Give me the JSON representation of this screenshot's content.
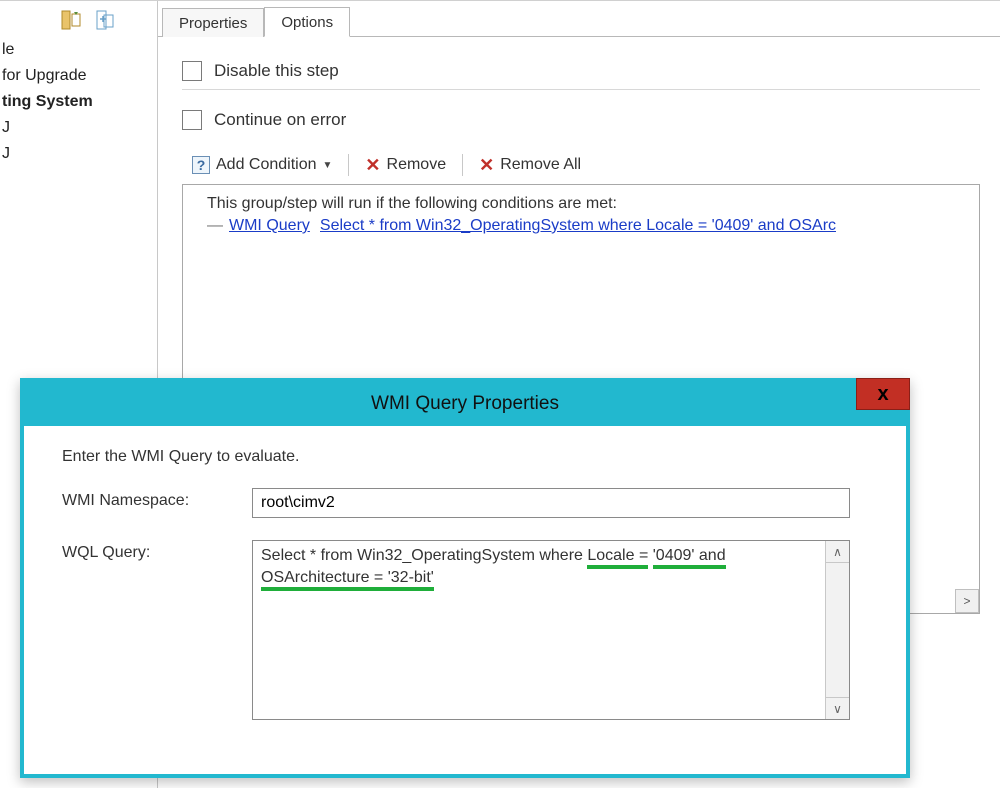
{
  "tree": {
    "items": [
      "le",
      "for Upgrade",
      "ting System",
      "J",
      "J"
    ],
    "selected_index": 2
  },
  "tabs": {
    "properties": "Properties",
    "options": "Options"
  },
  "options": {
    "disable_step": "Disable this step",
    "continue_on_error": "Continue on error",
    "add_condition": "Add Condition",
    "remove": "Remove",
    "remove_all": "Remove All"
  },
  "conditions": {
    "message": "This group/step will run if the following conditions are met:",
    "row_label": "WMI Query",
    "row_text": "Select * from Win32_OperatingSystem where Locale = '0409' and OSArc"
  },
  "dialog": {
    "title": "WMI Query Properties",
    "hint": "Enter the WMI Query to evaluate.",
    "namespace_label": "WMI Namespace:",
    "namespace_value": "root\\cimv2",
    "wql_label": "WQL Query:",
    "wql_part1": "Select * from Win32_OperatingSystem where ",
    "wql_hl1": "Locale =",
    "wql_hl2": "'0409' and OSArchitecture = '32-bit'",
    "close": "x"
  }
}
